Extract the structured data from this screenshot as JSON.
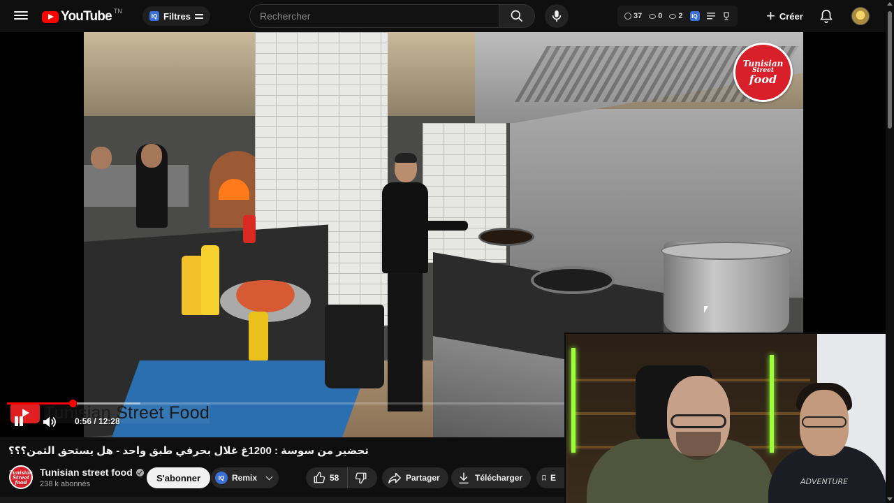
{
  "header": {
    "logo_text": "YouTube",
    "logo_region": "TN",
    "filters_label": "Filtres",
    "iq_badge": "IQ",
    "search_placeholder": "Rechercher",
    "stats": {
      "history_count": "37",
      "views_a": "0",
      "views_b": "2"
    },
    "create_label": "Créer"
  },
  "player": {
    "watermark": {
      "line1": "Tunisian",
      "line2": "Street",
      "line3": "food"
    },
    "lower_third_text": "Tunisian Street Food",
    "time_current": "0:56",
    "time_total": "12:28",
    "time_display": "0:56 / 12:28",
    "progress_played_fraction": 0.075,
    "progress_buffered_fraction": 0.153,
    "accent_color": "#ff0000"
  },
  "facecam": {
    "shirt_text": "ADVENTURE"
  },
  "video_info": {
    "title": "تحضير من سوسة : 1200غ غلال بحرفي طبق واحد - هل يستحق الثمن؟؟؟",
    "channel_name": "Tunisian street food",
    "channel_avatar_text": "Tunisian Street food",
    "subscribers": "238 k abonnés",
    "subscribe_label": "S'abonner",
    "remix_label": "Remix",
    "like_count": "58",
    "share_label": "Partager",
    "download_label": "Télécharger",
    "save_label_partial": "E"
  }
}
